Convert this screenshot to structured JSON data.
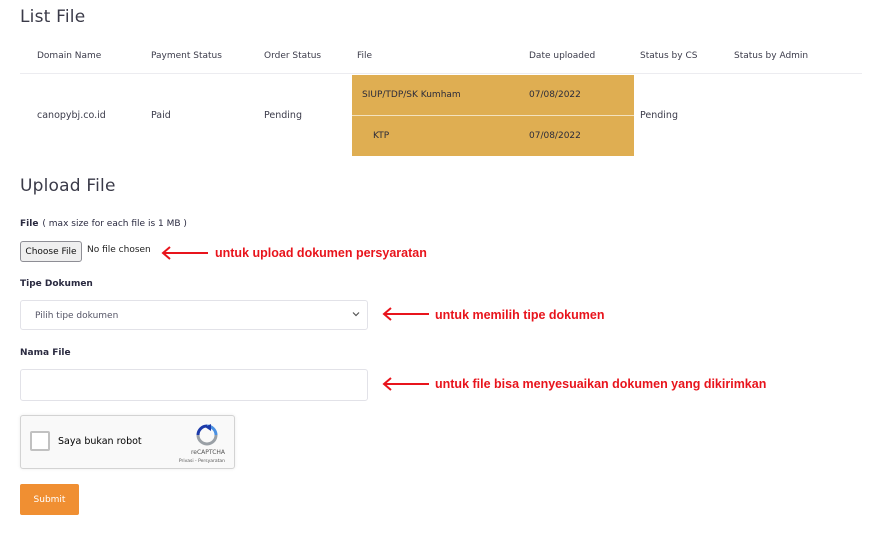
{
  "list_section": {
    "title": "List File",
    "columns": [
      "Domain Name",
      "Payment Status",
      "Order Status",
      "File",
      "Date uploaded",
      "Status by CS",
      "Status by Admin"
    ],
    "row": {
      "domain": "canopybj.co.id",
      "payment_status": "Paid",
      "order_status": "Pending",
      "files": [
        {
          "name": "SIUP/TDP/SK Kumham",
          "date": "07/08/2022"
        },
        {
          "name": "KTP",
          "date": "07/08/2022"
        }
      ],
      "status_cs": "Pending",
      "status_admin": ""
    },
    "file_highlight_color": "#dfae52"
  },
  "upload_section": {
    "title": "Upload File",
    "file_label": "File",
    "file_note": "( max size for each file is 1 MB )",
    "choose_button": "Choose File",
    "no_file_text": "No file chosen",
    "doc_type_label": "Tipe Dokumen",
    "doc_type_placeholder": "Pilih tipe dokumen",
    "file_name_label": "Nama File",
    "file_name_value": "",
    "captcha_label": "Saya bukan robot",
    "captcha_brand": "reCAPTCHA",
    "captcha_terms": "Privasi - Persyaratan",
    "submit_label": "Submit",
    "submit_color": "#f08f32"
  },
  "annotations": {
    "upload": "untuk upload dokumen persyaratan",
    "doc_type": "untuk memilih tipe dokumen",
    "file_name": "untuk file bisa menyesuaikan dokumen yang dikirimkan",
    "color": "#e8141c"
  }
}
